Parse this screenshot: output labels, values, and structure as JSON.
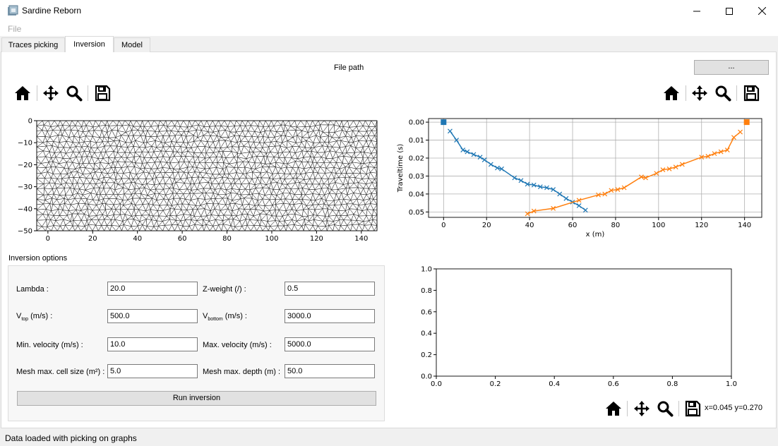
{
  "window": {
    "title": "Sardine Reborn"
  },
  "menu": {
    "file": "File"
  },
  "tabs": [
    {
      "label": "Traces picking",
      "active": false
    },
    {
      "label": "Inversion",
      "active": true
    },
    {
      "label": "Model",
      "active": false
    }
  ],
  "file_path": {
    "label": "File path",
    "browse": "..."
  },
  "toolbar_icons": [
    "home-icon",
    "move-icon",
    "zoom-icon",
    "save-icon"
  ],
  "options": {
    "group_title": "Inversion options",
    "lambda_label": "Lambda :",
    "lambda_value": "20.0",
    "zweight_label": "Z-weight (/) :",
    "zweight_value": "0.5",
    "vtop_label_main": "V",
    "vtop_label_sub": "top",
    "vtop_label_unit": " (m/s) :",
    "vtop_value": "500.0",
    "vbottom_label_main": "V",
    "vbottom_label_sub": "bottom",
    "vbottom_label_unit": " (m/s) :",
    "vbottom_value": "3000.0",
    "minvel_label": "Min. velocity (m/s) :",
    "minvel_value": "10.0",
    "maxvel_label": "Max. velocity (m/s) :",
    "maxvel_value": "5000.0",
    "cellsize_label": "Mesh max. cell size (m²) :",
    "cellsize_value": "5.0",
    "maxdepth_label": "Mesh max. depth (m) :",
    "maxdepth_value": "50.0",
    "run_button": "Run inversion"
  },
  "coords_readout": "x=0.045 y=0.270",
  "status": "Data loaded with picking on graphs",
  "chart_data": [
    {
      "type": "mesh",
      "xlim": [
        -5,
        147
      ],
      "ylim": [
        -50,
        0
      ],
      "xticks": [
        0,
        20,
        40,
        60,
        80,
        100,
        120,
        140
      ],
      "yticks": [
        0,
        -10,
        -20,
        -30,
        -40,
        -50
      ],
      "xtick_labels": [
        "0",
        "20",
        "40",
        "60",
        "80",
        "100",
        "120",
        "140"
      ],
      "ytick_labels": [
        "0",
        "−10",
        "−20",
        "−30",
        "−40",
        "−50"
      ]
    },
    {
      "type": "line",
      "xlabel": "x (m)",
      "ylabel": "Traveltime (s)",
      "xlim": [
        -7,
        148
      ],
      "ylim": [
        0.053,
        -0.002
      ],
      "y_inverted": true,
      "grid": true,
      "xticks": [
        0,
        20,
        40,
        60,
        80,
        100,
        120,
        140
      ],
      "yticks": [
        0.0,
        0.01,
        0.02,
        0.03,
        0.04,
        0.05
      ],
      "xtick_labels": [
        "0",
        "20",
        "40",
        "60",
        "80",
        "100",
        "120",
        "140"
      ],
      "ytick_labels": [
        "0.00",
        "0.01",
        "0.02",
        "0.03",
        "0.04",
        "0.05"
      ],
      "series": [
        {
          "color": "#1f77b4",
          "source": [
            0,
            0.0
          ],
          "x": [
            3,
            6,
            9,
            11,
            14,
            17,
            19,
            22,
            25,
            27,
            33,
            36,
            39,
            42,
            45,
            48,
            51,
            54,
            57,
            60,
            63,
            66
          ],
          "y": [
            0.005,
            0.01,
            0.0155,
            0.0165,
            0.018,
            0.0195,
            0.021,
            0.0235,
            0.0255,
            0.026,
            0.031,
            0.0325,
            0.0345,
            0.035,
            0.036,
            0.0365,
            0.0375,
            0.04,
            0.0425,
            0.0445,
            0.0465,
            0.049
          ]
        },
        {
          "color": "#ff7f0e",
          "source": [
            141,
            0.0
          ],
          "x": [
            39,
            42,
            51,
            63,
            72,
            75,
            78,
            81,
            84,
            92,
            94,
            99,
            102,
            105,
            108,
            111,
            120,
            123,
            126,
            129,
            132,
            135,
            138
          ],
          "y": [
            0.051,
            0.0495,
            0.048,
            0.0435,
            0.0405,
            0.04,
            0.038,
            0.0375,
            0.0365,
            0.0305,
            0.031,
            0.0285,
            0.0265,
            0.026,
            0.025,
            0.0235,
            0.0195,
            0.019,
            0.0175,
            0.0165,
            0.0155,
            0.0085,
            0.0055
          ]
        }
      ]
    },
    {
      "type": "empty",
      "xlim": [
        0,
        1
      ],
      "ylim": [
        0,
        1
      ],
      "xticks": [
        0,
        0.2,
        0.4,
        0.6,
        0.8,
        1.0
      ],
      "yticks": [
        0,
        0.2,
        0.4,
        0.6,
        0.8,
        1.0
      ],
      "xtick_labels": [
        "0.0",
        "0.2",
        "0.4",
        "0.6",
        "0.8",
        "1.0"
      ],
      "ytick_labels": [
        "0.0",
        "0.2",
        "0.4",
        "0.6",
        "0.8",
        "1.0"
      ]
    }
  ]
}
